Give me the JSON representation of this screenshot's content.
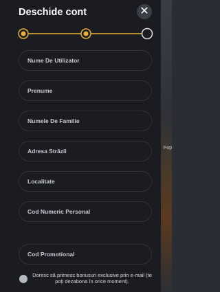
{
  "modal": {
    "title": "Deschide cont",
    "close_symbol": "✕"
  },
  "stepper": {
    "active_color": "#e8b13c",
    "inactive_color": "#e0e0e0",
    "steps_completed": 2,
    "steps_total": 3
  },
  "form": {
    "fields": [
      {
        "label": "Nume De Utilizator"
      },
      {
        "label": "Prenume"
      },
      {
        "label": "Numele De Familie"
      },
      {
        "label": "Adresa Străzii"
      },
      {
        "label": "Localitate"
      },
      {
        "label": "Cod Numeric Personal"
      },
      {
        "label": "Cod Promotional"
      }
    ]
  },
  "consent": {
    "text": "Doresc să primesc bonusuri exclusive prin e-mail (te poți dezabona în orice moment)."
  },
  "background": {
    "partial_text": "Pop"
  }
}
